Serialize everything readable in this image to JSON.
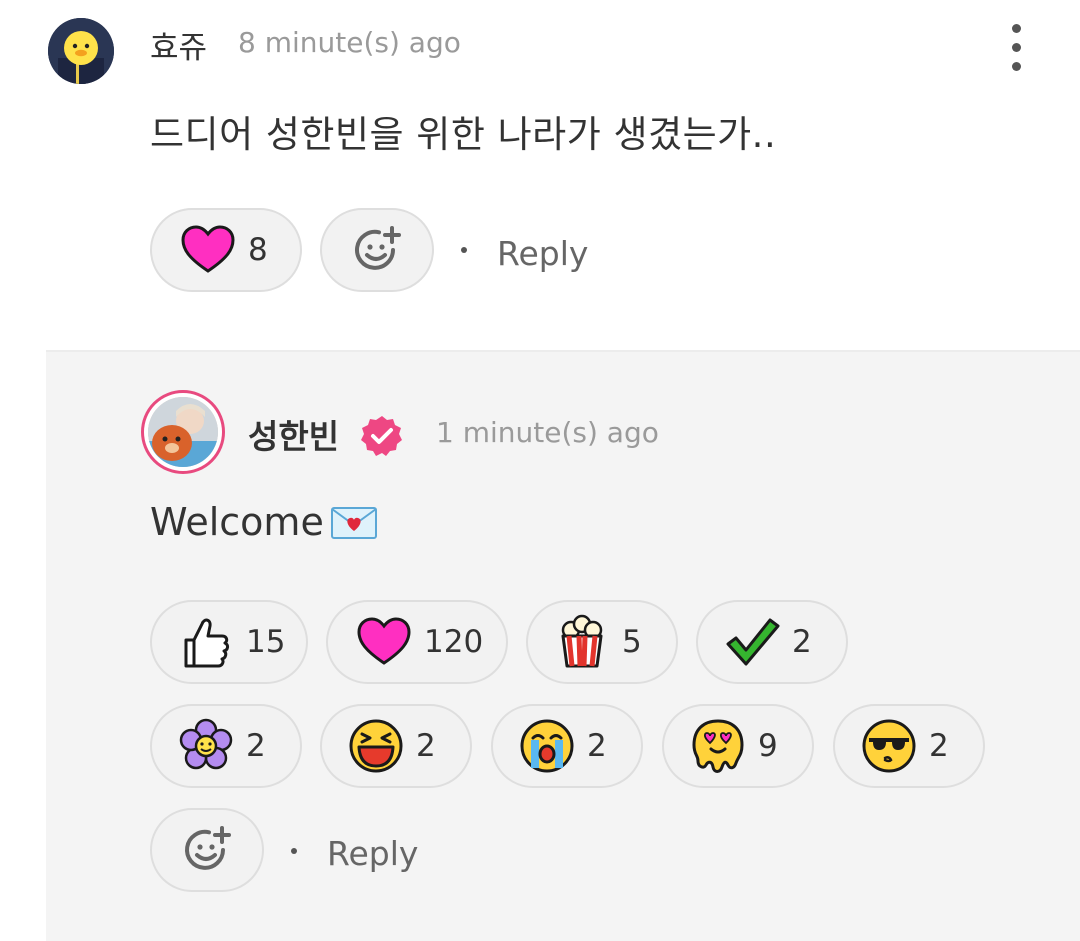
{
  "parent_comment": {
    "author": "효쥬",
    "time": "8 minute(s) ago",
    "text": "드디어 성한빈을 위한 나라가 생겼는가..",
    "reactions": [
      {
        "icon": "pink-heart-icon",
        "count": "8"
      }
    ],
    "reply_label": "Reply"
  },
  "reply_comment": {
    "author": "성한빈",
    "time": "1 minute(s) ago",
    "text": "Welcome",
    "reactions": [
      {
        "icon": "thumbs-up-icon",
        "count": "15"
      },
      {
        "icon": "pink-heart-icon",
        "count": "120"
      },
      {
        "icon": "popcorn-icon",
        "count": "5"
      },
      {
        "icon": "check-mark-icon",
        "count": "2"
      },
      {
        "icon": "purple-flower-icon",
        "count": "2"
      },
      {
        "icon": "laughing-face-icon",
        "count": "2"
      },
      {
        "icon": "crying-face-icon",
        "count": "2"
      },
      {
        "icon": "melting-heart-eyes-icon",
        "count": "9"
      },
      {
        "icon": "sunglasses-face-icon",
        "count": "2"
      }
    ],
    "reply_label": "Reply"
  },
  "colors": {
    "accent_pink": "#e84a7f",
    "heart": "#ff2fc1",
    "reply_bg": "#f4f4f4"
  }
}
